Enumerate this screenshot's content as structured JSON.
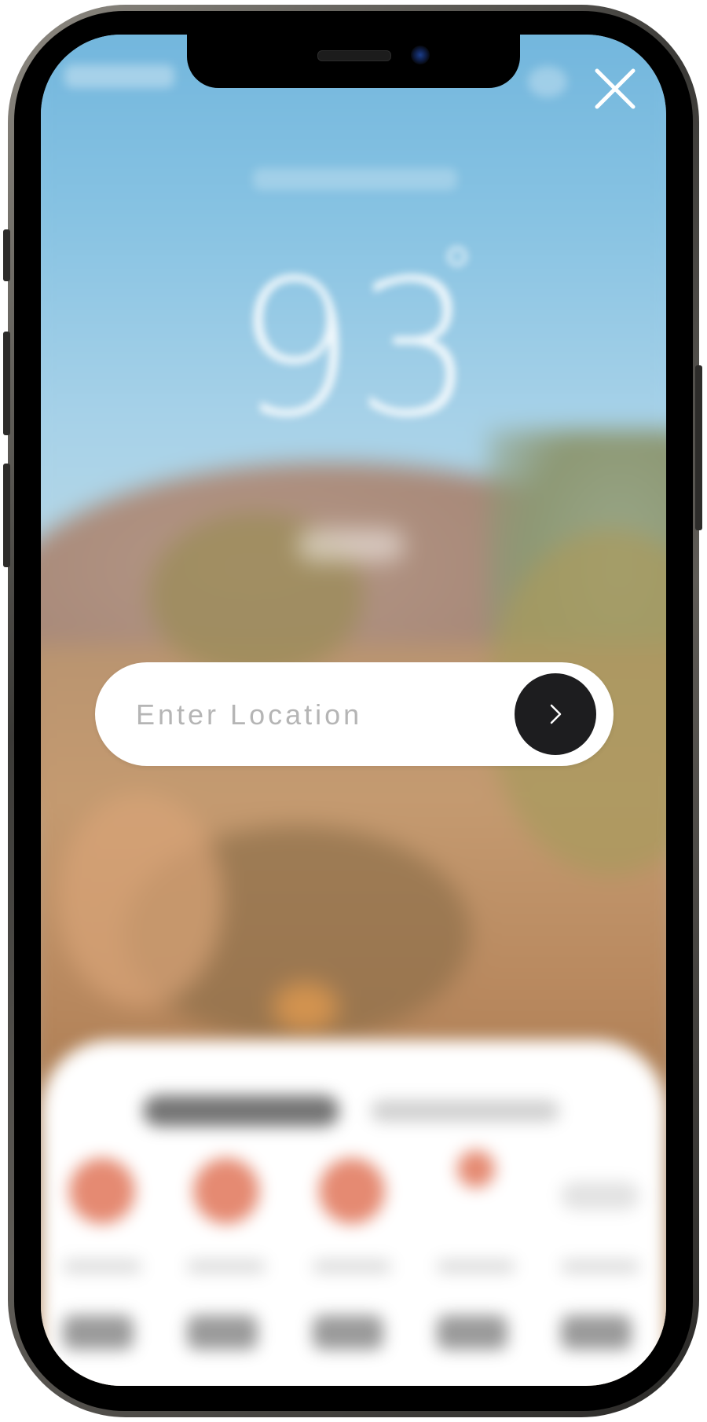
{
  "search": {
    "placeholder": "Enter Location",
    "value": ""
  },
  "current": {
    "temperature": "93",
    "degree_symbol": "°"
  },
  "icons": {
    "close": "close-icon",
    "submit": "chevron-right-icon"
  },
  "colors": {
    "go_button": "#1d1d1f",
    "pill_background": "#ffffff",
    "close_icon": "#ffffff",
    "sun_accent": "#e58a72"
  }
}
